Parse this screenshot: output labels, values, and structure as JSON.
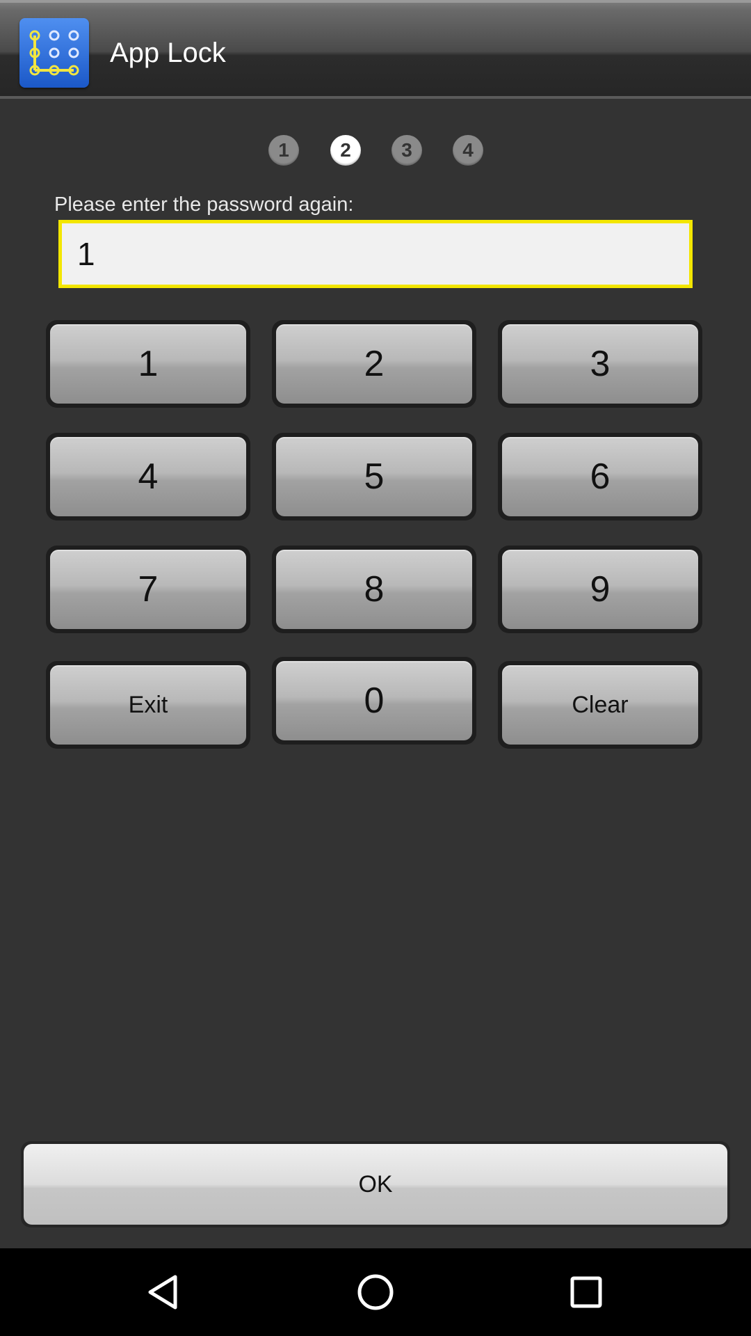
{
  "app_bar": {
    "title": "App Lock",
    "icon": "grid-lock-icon"
  },
  "steps": [
    "1",
    "2",
    "3",
    "4"
  ],
  "active_step": "2",
  "prompt": "Please enter the password again:",
  "password_field": {
    "value": "1"
  },
  "keypad": {
    "k1": "1",
    "k2": "2",
    "k3": "3",
    "k4": "4",
    "k5": "5",
    "k6": "6",
    "k7": "7",
    "k8": "8",
    "k9": "9",
    "exit": "Exit",
    "k0": "0",
    "clear": "Clear"
  },
  "ok_label": "OK",
  "colors": {
    "field_border": "#f3e600",
    "app_icon": "#2f6fe0"
  },
  "nav": {
    "back_icon": "back-triangle-icon",
    "home_icon": "home-circle-icon",
    "recents_icon": "recents-square-icon"
  }
}
